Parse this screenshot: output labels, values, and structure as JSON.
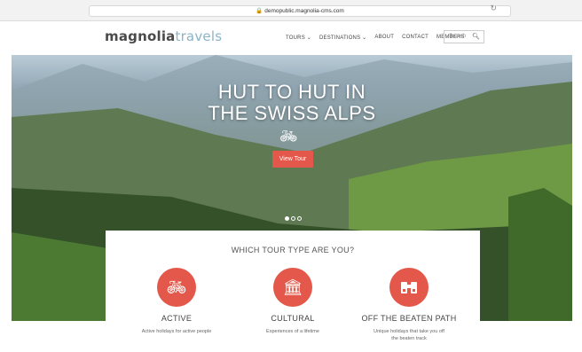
{
  "browser": {
    "url": "demopublic.magnolia-cms.com"
  },
  "header": {
    "logo_part1": "magnolia",
    "logo_part2": "travels",
    "nav": [
      "TOURS ⌄",
      "DESTINATIONS ⌄",
      "ABOUT",
      "CONTACT",
      "MEMBERS"
    ],
    "search_placeholder": "Search"
  },
  "hero": {
    "title_line1": "HUT TO HUT IN",
    "title_line2": "THE SWISS ALPS",
    "button": "View Tour",
    "slides": 3,
    "active_slide": 1
  },
  "tour_types": {
    "heading": "WHICH TOUR TYPE ARE YOU?",
    "items": [
      {
        "name": "ACTIVE",
        "desc": "Active holidays for active people",
        "icon": "bicycle-icon"
      },
      {
        "name": "CULTURAL",
        "desc": "Experiences of a lifetime",
        "icon": "temple-icon"
      },
      {
        "name": "OFF THE BEATEN PATH",
        "desc": "Unique holidays that take you off the beaten track",
        "icon": "binoculars-icon"
      }
    ]
  },
  "colors": {
    "accent": "#e3584a",
    "logo_light": "#8ab4c9"
  }
}
